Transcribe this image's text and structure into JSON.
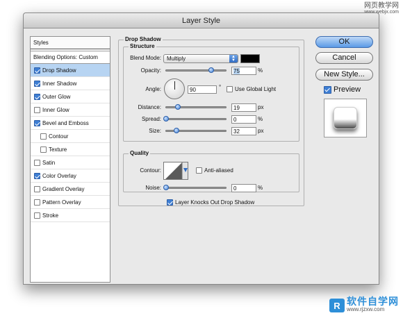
{
  "window": {
    "title": "Layer Style"
  },
  "left": {
    "styles_header": "Styles",
    "blending_options": "Blending Options: Custom",
    "items": [
      {
        "label": "Drop Shadow",
        "checked": true,
        "selected": true,
        "sub": false
      },
      {
        "label": "Inner Shadow",
        "checked": true,
        "selected": false,
        "sub": false
      },
      {
        "label": "Outer Glow",
        "checked": true,
        "selected": false,
        "sub": false
      },
      {
        "label": "Inner Glow",
        "checked": false,
        "selected": false,
        "sub": false
      },
      {
        "label": "Bevel and Emboss",
        "checked": true,
        "selected": false,
        "sub": false
      },
      {
        "label": "Contour",
        "checked": false,
        "selected": false,
        "sub": true
      },
      {
        "label": "Texture",
        "checked": false,
        "selected": false,
        "sub": true
      },
      {
        "label": "Satin",
        "checked": false,
        "selected": false,
        "sub": false
      },
      {
        "label": "Color Overlay",
        "checked": true,
        "selected": false,
        "sub": false
      },
      {
        "label": "Gradient Overlay",
        "checked": false,
        "selected": false,
        "sub": false
      },
      {
        "label": "Pattern Overlay",
        "checked": false,
        "selected": false,
        "sub": false
      },
      {
        "label": "Stroke",
        "checked": false,
        "selected": false,
        "sub": false
      }
    ]
  },
  "drop_shadow": {
    "title": "Drop Shadow",
    "structure": {
      "title": "Structure",
      "blend_mode_label": "Blend Mode:",
      "blend_mode_value": "Multiply",
      "shadow_color": "#000000",
      "opacity_label": "Opacity:",
      "opacity_value": "75",
      "opacity_unit": "%",
      "opacity_fraction": 0.75,
      "angle_label": "Angle:",
      "angle_value": "90",
      "angle_unit": "°",
      "use_global_light_label": "Use Global Light",
      "use_global_light_checked": false,
      "distance_label": "Distance:",
      "distance_value": "19",
      "distance_unit": "px",
      "distance_fraction": 0.2,
      "spread_label": "Spread:",
      "spread_value": "0",
      "spread_unit": "%",
      "spread_fraction": 0.0,
      "size_label": "Size:",
      "size_value": "32",
      "size_unit": "px",
      "size_fraction": 0.18
    },
    "quality": {
      "title": "Quality",
      "contour_label": "Contour:",
      "anti_aliased_label": "Anti-aliased",
      "anti_aliased_checked": false,
      "noise_label": "Noise:",
      "noise_value": "0",
      "noise_unit": "%",
      "noise_fraction": 0.0
    },
    "knocks_out_label": "Layer Knocks Out Drop Shadow",
    "knocks_out_checked": true
  },
  "buttons": {
    "ok": "OK",
    "cancel": "Cancel",
    "new_style": "New Style...",
    "preview_label": "Preview",
    "preview_checked": true
  },
  "watermarks": {
    "top_cn": "网页教学网",
    "top_url": "www.webjx.com",
    "logo_letter": "R",
    "bottom_cn": "软件自学网",
    "bottom_url": "www.rjzxw.com"
  }
}
